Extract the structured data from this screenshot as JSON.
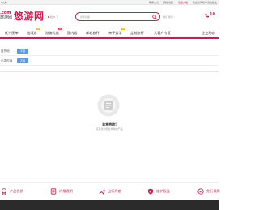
{
  "topbar": {
    "left_text": "ı 入驻",
    "links": [
      "联系方式",
      "网站地图",
      "团体上线",
      "欢迎访问哈尔滨热拍主"
    ],
    "accent_link": "欢迎入驻"
  },
  "header": {
    "logo_small": ".com",
    "logo_cn": "旅游网",
    "logo_big": "悠游网",
    "city": "哈尔",
    "search_placeholder": "搜索线路",
    "hot_text": "热门搜索",
    "hot_chevron": "›",
    "hotline": "10"
  },
  "nav": {
    "items": [
      {
        "label": "优兴图单",
        "badge": ""
      },
      {
        "label": "出境游",
        "badge": "热"
      },
      {
        "label": "港澳优选",
        "badge": "新"
      },
      {
        "label": "国内游",
        "badge": ""
      },
      {
        "label": "邮轮旅行",
        "badge": ""
      },
      {
        "label": "亲子游学",
        "badge": "热"
      },
      {
        "label": "定制旅行",
        "badge": ""
      },
      {
        "label": "大客户专区",
        "badge": ""
      },
      {
        "label": "企业动态",
        "badge": ""
      }
    ]
  },
  "filters": [
    {
      "label": "目的地",
      "chip": "不限"
    },
    {
      "label": "出发时间",
      "chip": "不限"
    }
  ],
  "empty": {
    "title": "非常抱歉!",
    "subtitle": "没有找到符合条件的产品"
  },
  "services": [
    {
      "label": "产品优质",
      "icon": "badge-icon"
    },
    {
      "label": "价格透明",
      "icon": "price-icon"
    },
    {
      "label": "出行约定",
      "icon": "travel-icon"
    },
    {
      "label": "维护权益",
      "icon": "shield-icon"
    },
    {
      "label": "免行保障",
      "icon": "guarantee-icon"
    }
  ],
  "colors": {
    "brand": "#d11a4a",
    "chip": "#5b9be5",
    "footer": "#2b2b2b"
  }
}
